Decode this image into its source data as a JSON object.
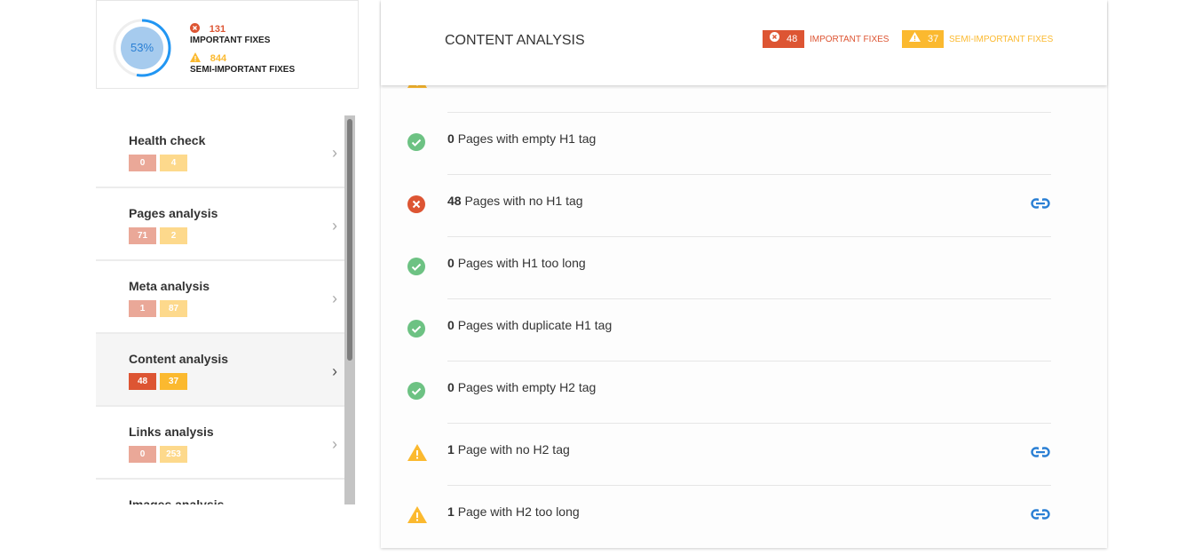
{
  "summary": {
    "percent": "53%",
    "percent_value": 53,
    "important_count": "131",
    "important_label": "IMPORTANT FIXES",
    "semi_count": "844",
    "semi_label": "SEMI-IMPORTANT FIXES"
  },
  "colors": {
    "error": "#dd5533",
    "warning": "#fbb92f",
    "success": "#6dc283",
    "link": "#2a7fd4",
    "error_light": "#eaa898",
    "warning_light": "#fdd98c"
  },
  "sidebar": {
    "items": [
      {
        "label": "Health check",
        "important": "0",
        "semi": "4",
        "active": false
      },
      {
        "label": "Pages analysis",
        "important": "71",
        "semi": "2",
        "active": false
      },
      {
        "label": "Meta analysis",
        "important": "1",
        "semi": "87",
        "active": false
      },
      {
        "label": "Content analysis",
        "important": "48",
        "semi": "37",
        "active": true
      },
      {
        "label": "Links analysis",
        "important": "0",
        "semi": "253",
        "active": false
      },
      {
        "label": "Images analysis",
        "important": "",
        "semi": "",
        "active": false
      }
    ]
  },
  "main": {
    "title": "CONTENT ANALYSIS",
    "important_count": "48",
    "important_label": "IMPORTANT FIXES",
    "semi_count": "37",
    "semi_label": "SEMI-IMPORTANT FIXES",
    "rows": [
      {
        "status": "warning",
        "count": "",
        "text": "",
        "link": false
      },
      {
        "status": "success",
        "count": "0",
        "text": "Pages with empty H1 tag",
        "link": false
      },
      {
        "status": "error",
        "count": "48",
        "text": "Pages with no H1 tag",
        "link": true
      },
      {
        "status": "success",
        "count": "0",
        "text": "Pages with H1 too long",
        "link": false
      },
      {
        "status": "success",
        "count": "0",
        "text": "Pages with duplicate H1 tag",
        "link": false
      },
      {
        "status": "success",
        "count": "0",
        "text": "Pages with empty H2 tag",
        "link": false
      },
      {
        "status": "warning",
        "count": "1",
        "text": "Page with no H2 tag",
        "link": true
      },
      {
        "status": "warning",
        "count": "1",
        "text": "Page with H2 too long",
        "link": true
      }
    ]
  }
}
